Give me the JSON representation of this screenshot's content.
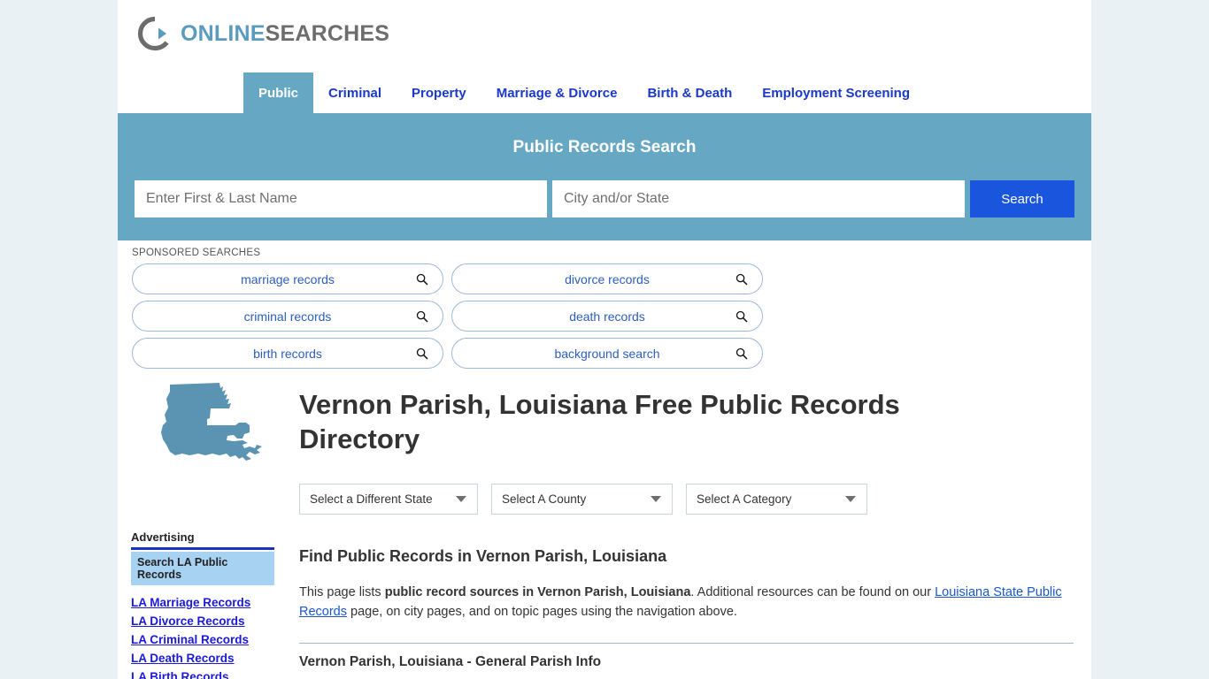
{
  "site": {
    "logo_online": "ONLINE",
    "logo_searches": "SEARCHES",
    "logo_icon": "circle-arrow-icon"
  },
  "nav": {
    "tabs": [
      {
        "label": "Public",
        "active": true
      },
      {
        "label": "Criminal",
        "active": false
      },
      {
        "label": "Property",
        "active": false
      },
      {
        "label": "Marriage & Divorce",
        "active": false
      },
      {
        "label": "Birth & Death",
        "active": false
      },
      {
        "label": "Employment Screening",
        "active": false
      }
    ]
  },
  "search": {
    "title": "Public Records Search",
    "name_placeholder": "Enter First & Last Name",
    "name_value": "",
    "city_placeholder": "City and/or State",
    "city_value": "",
    "button_label": "Search"
  },
  "sponsored": {
    "label": "SPONSORED SEARCHES",
    "items": [
      {
        "label": "marriage records",
        "icon": "magnifier-icon"
      },
      {
        "label": "divorce records",
        "icon": "magnifier-icon"
      },
      {
        "label": "criminal records",
        "icon": "magnifier-icon"
      },
      {
        "label": "death records",
        "icon": "magnifier-icon"
      },
      {
        "label": "birth records",
        "icon": "magnifier-icon"
      },
      {
        "label": "background search",
        "icon": "magnifier-icon"
      }
    ]
  },
  "main": {
    "state_map_icon": "louisiana-state-map-icon",
    "page_title": "Vernon Parish, Louisiana Free Public Records Directory",
    "selectors": [
      {
        "label": "Select a Different State"
      },
      {
        "label": "Select A County"
      },
      {
        "label": "Select A Category"
      }
    ],
    "section_heading": "Find Public Records in Vernon Parish, Louisiana",
    "paragraph": {
      "part1": "This page lists ",
      "bold": "public record sources in Vernon Parish, Louisiana",
      "part2": ". Additional resources can be found on our ",
      "link": "Louisiana State Public Records",
      "part3": " page, on city pages, and on topic pages using the navigation above."
    },
    "sub_section_title": "Vernon Parish, Louisiana - General Parish Info"
  },
  "sidebar": {
    "ad_heading": "Advertising",
    "ad_search_heading": "Search LA Public Records",
    "links": [
      "LA Marriage Records",
      "LA Divorce Records",
      "LA Criminal Records",
      "LA Death Records",
      "LA Birth Records"
    ]
  },
  "colors": {
    "banner_teal": "#66a8c4",
    "link_blue": "#1a39c4",
    "button_blue": "#1a56dd",
    "page_bg": "#eaf1f5",
    "map_teal": "#5b93b3",
    "ad_highlight": "#a8d2f2"
  }
}
